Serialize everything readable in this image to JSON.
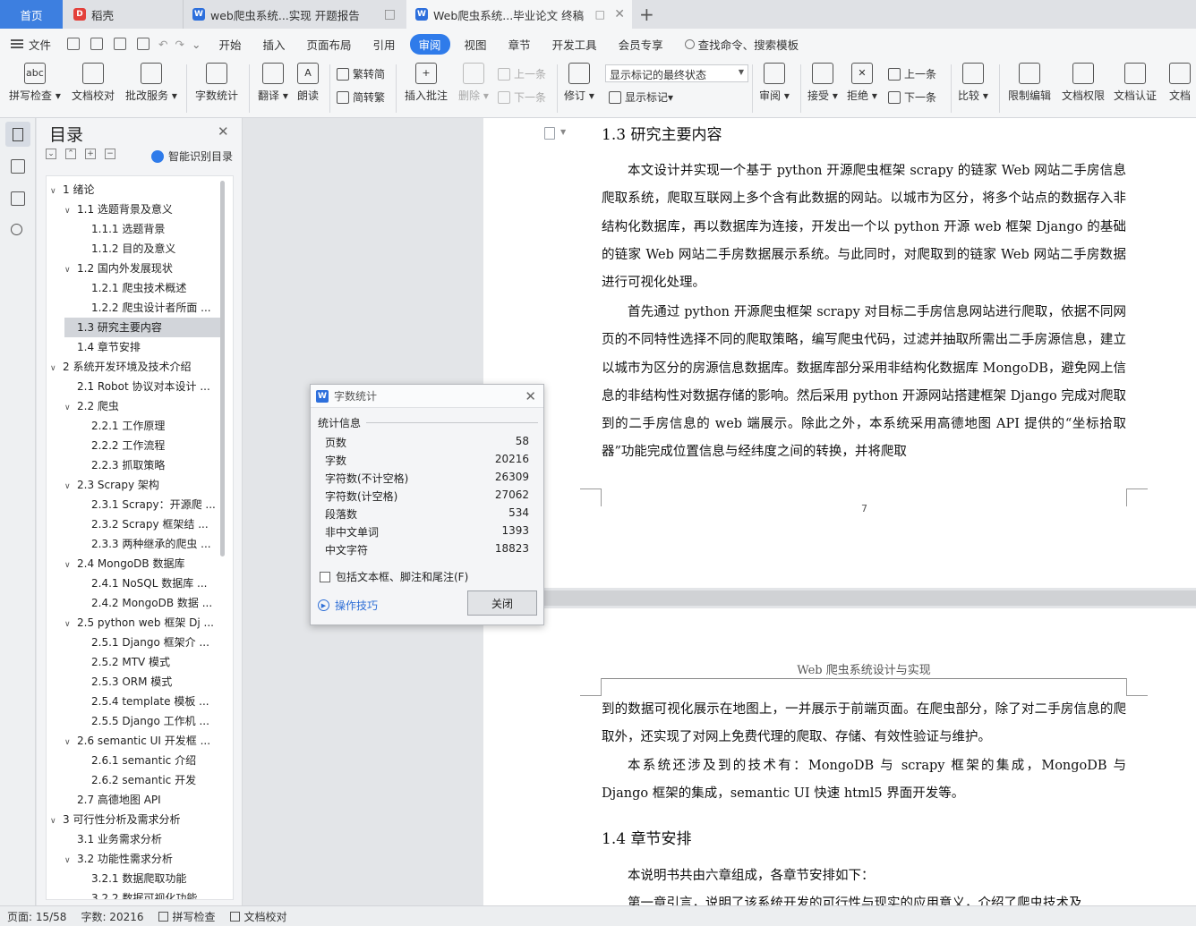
{
  "tabs": {
    "home": "首页",
    "daoke": "稻壳",
    "doc1": "web爬虫系统...实现 开题报告",
    "doc2": "Web爬虫系统...毕业论文 终稿"
  },
  "menu": {
    "file": "文件",
    "items": [
      "开始",
      "插入",
      "页面布局",
      "引用",
      "审阅",
      "视图",
      "章节",
      "开发工具",
      "会员专享"
    ],
    "active": "审阅",
    "search": "查找命令、搜索模板"
  },
  "ribbon": {
    "spell_check": "拼写检查",
    "doc_proof": "文档校对",
    "batch_service": "批改服务",
    "word_count": "字数统计",
    "translate": "翻译",
    "read_aloud": "朗读",
    "trad_to_simp": "繁转简",
    "simp_to_trad": "简转繁",
    "insert_comment": "插入批注",
    "delete": "删除",
    "prev_comment": "上一条",
    "next_comment": "下一条",
    "revise": "修订",
    "markup_state": "显示标记的最终状态",
    "show_markup": "显示标记",
    "review": "审阅",
    "accept": "接受",
    "reject": "拒绝",
    "prev_change": "上一条",
    "next_change": "下一条",
    "compare": "比较",
    "restrict_edit": "限制编辑",
    "doc_permission": "文档权限",
    "doc_certify": "文档认证",
    "doc_more": "文档"
  },
  "toc": {
    "title": "目录",
    "smart": "智能识别目录",
    "items": [
      {
        "text": "1  绪论",
        "level": 1,
        "arrow": true
      },
      {
        "text": "1.1  选题背景及意义",
        "level": 2,
        "arrow": true
      },
      {
        "text": "1.1.1 选题背景",
        "level": 3,
        "arrow": false
      },
      {
        "text": "1.1.2 目的及意义",
        "level": 3,
        "arrow": false
      },
      {
        "text": "1.2  国内外发展现状",
        "level": 2,
        "arrow": true
      },
      {
        "text": "1.2.1  爬虫技术概述",
        "level": 3,
        "arrow": false
      },
      {
        "text": "1.2.2  爬虫设计者所面 ...",
        "level": 3,
        "arrow": false
      },
      {
        "text": "1.3  研究主要内容",
        "level": 2,
        "arrow": false,
        "selected": true
      },
      {
        "text": "1.4  章节安排",
        "level": 2,
        "arrow": false
      },
      {
        "text": "2  系统开发环境及技术介绍",
        "level": 1,
        "arrow": true
      },
      {
        "text": "2.1 Robot 协议对本设计 ...",
        "level": 2,
        "arrow": false
      },
      {
        "text": "2.2  爬虫",
        "level": 2,
        "arrow": true
      },
      {
        "text": "2.2.1  工作原理",
        "level": 3,
        "arrow": false
      },
      {
        "text": "2.2.2  工作流程",
        "level": 3,
        "arrow": false
      },
      {
        "text": "2.2.3  抓取策略",
        "level": 3,
        "arrow": false
      },
      {
        "text": "2.3 Scrapy 架构",
        "level": 2,
        "arrow": true
      },
      {
        "text": "2.3.1 Scrapy：开源爬 ...",
        "level": 3,
        "arrow": false
      },
      {
        "text": "2.3.2 Scrapy 框架结 ...",
        "level": 3,
        "arrow": false
      },
      {
        "text": "2.3.3  两种继承的爬虫 ...",
        "level": 3,
        "arrow": false
      },
      {
        "text": "2.4 MongoDB 数据库",
        "level": 2,
        "arrow": true
      },
      {
        "text": "2.4.1 NoSQL 数据库 ...",
        "level": 3,
        "arrow": false
      },
      {
        "text": "2.4.2 MongoDB 数据 ...",
        "level": 3,
        "arrow": false
      },
      {
        "text": "2.5 python web 框架 Dj ...",
        "level": 2,
        "arrow": true
      },
      {
        "text": "2.5.1 Django 框架介 ...",
        "level": 3,
        "arrow": false
      },
      {
        "text": "2.5.2 MTV 模式",
        "level": 3,
        "arrow": false
      },
      {
        "text": "2.5.3 ORM 模式",
        "level": 3,
        "arrow": false
      },
      {
        "text": "2.5.4 template 模板 ...",
        "level": 3,
        "arrow": false
      },
      {
        "text": "2.5.5 Django 工作机 ...",
        "level": 3,
        "arrow": false
      },
      {
        "text": "2.6 semantic UI 开发框 ...",
        "level": 2,
        "arrow": true
      },
      {
        "text": "2.6.1 semantic 介绍",
        "level": 3,
        "arrow": false
      },
      {
        "text": "2.6.2 semantic 开发",
        "level": 3,
        "arrow": false
      },
      {
        "text": "2.7  高德地图 API",
        "level": 2,
        "arrow": false
      },
      {
        "text": "3  可行性分析及需求分析",
        "level": 1,
        "arrow": true
      },
      {
        "text": "3.1  业务需求分析",
        "level": 2,
        "arrow": false
      },
      {
        "text": "3.2  功能性需求分析",
        "level": 2,
        "arrow": true
      },
      {
        "text": "3.2.1  数据爬取功能",
        "level": 3,
        "arrow": false
      },
      {
        "text": "3.2.2  数据可视化功能",
        "level": 3,
        "arrow": false
      }
    ]
  },
  "document": {
    "heading_13": "1.3  研究主要内容",
    "p1": "本文设计并实现一个基于 python 开源爬虫框架 scrapy 的链家 Web 网站二手房信息爬取系统，爬取互联网上多个含有此数据的网站。以城市为区分，将多个站点的数据存入非结构化数据库，再以数据库为连接，开发出一个以 python 开源 web 框架 Django 的基础的链家 Web 网站二手房数据展示系统。与此同时，对爬取到的链家 Web 网站二手房数据进行可视化处理。",
    "p2": "首先通过 python 开源爬虫框架 scrapy 对目标二手房信息网站进行爬取，依据不同网页的不同特性选择不同的爬取策略，编写爬虫代码，过滤并抽取所需出二手房源信息，建立以城市为区分的房源信息数据库。数据库部分采用非结构化数据库 MongoDB，避免网上信息的非结构性对数据存储的影响。然后采用 python 开源网站搭建框架 Django 完成对爬取到的二手房信息的 web 端展示。除此之外，本系统采用高德地图 API 提供的“坐标拾取器”功能完成位置信息与经纬度之间的转换，并将爬取",
    "page_number": "7",
    "header": "Web 爬虫系统设计与实现",
    "p3": "到的数据可视化展示在地图上，一并展示于前端页面。在爬虫部分，除了对二手房信息的爬取外，还实现了对网上免费代理的爬取、存储、有效性验证与维护。",
    "p4": "本系统还涉及到的技术有：MongoDB 与 scrapy 框架的集成，MongoDB 与 Django 框架的集成，semantic UI 快速 html5 界面开发等。",
    "heading_14": "1.4  章节安排",
    "p5": "本说明书共由六章组成，各章节安排如下：",
    "p6": "第一章引言，说明了该系统开发的可行性与现实的应用意义，介绍了爬虫技术及"
  },
  "dialog": {
    "title": "字数统计",
    "section": "统计信息",
    "stats": [
      {
        "label": "页数",
        "value": "58"
      },
      {
        "label": "字数",
        "value": "20216"
      },
      {
        "label": "字符数(不计空格)",
        "value": "26309"
      },
      {
        "label": "字符数(计空格)",
        "value": "27062"
      },
      {
        "label": "段落数",
        "value": "534"
      },
      {
        "label": "非中文单词",
        "value": "1393"
      },
      {
        "label": "中文字符",
        "value": "18823"
      }
    ],
    "checkbox": "包括文本框、脚注和尾注(F)",
    "tips": "操作技巧",
    "close": "关闭"
  },
  "status": {
    "page": "页面: 15/58",
    "words": "字数: 20216",
    "spell": "拼写检查",
    "proof": "文档校对"
  }
}
